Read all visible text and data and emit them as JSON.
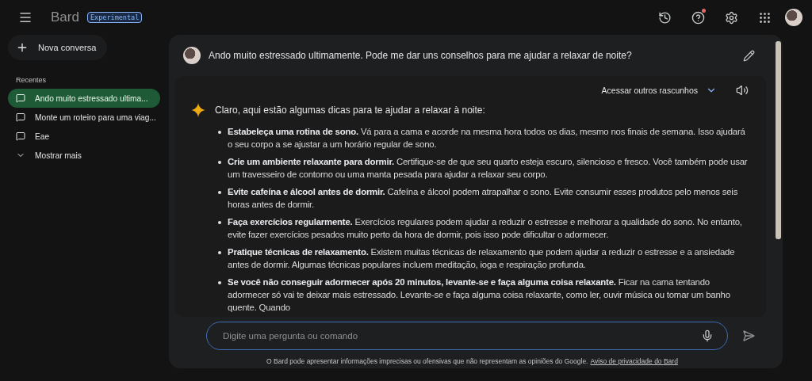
{
  "header": {
    "brand": "Bard",
    "badge": "Experimental",
    "help_notification": true
  },
  "sidebar": {
    "new_chat": "Nova conversa",
    "section": "Recentes",
    "items": [
      {
        "label": "Ando muito estressado ultima...",
        "selected": true
      },
      {
        "label": "Monte um roteiro para uma viag...",
        "selected": false
      },
      {
        "label": "Eae",
        "selected": false
      }
    ],
    "show_more": "Mostrar mais"
  },
  "prompt": {
    "text": "Ando muito estressado ultimamente. Pode me dar uns conselhos para me ajudar a relaxar de noite?"
  },
  "response": {
    "drafts_label": "Acessar outros rascunhos",
    "intro": "Claro, aqui estão algumas dicas para te ajudar a relaxar à noite:",
    "tips": [
      "**Estabeleça uma rotina de sono.** Vá para a cama e acorde na mesma hora todos os dias, mesmo nos finais de semana. Isso ajudará o seu corpo a se ajustar a um horário regular de sono.",
      "**Crie um ambiente relaxante para dormir.** Certifique-se de que seu quarto esteja escuro, silencioso e fresco. Você também pode usar um travesseiro de contorno ou uma manta pesada para ajudar a relaxar seu corpo.",
      "**Evite cafeína e álcool antes de dormir.** Cafeína e álcool podem atrapalhar o sono. Evite consumir esses produtos pelo menos seis horas antes de dormir.",
      "**Faça exercícios regularmente.** Exercícios regulares podem ajudar a reduzir o estresse e melhorar a qualidade do sono. No entanto, evite fazer exercícios pesados muito perto da hora de dormir, pois isso pode dificultar o adormecer.",
      "**Pratique técnicas de relaxamento.** Existem muitas técnicas de relaxamento que podem ajudar a reduzir o estresse e a ansiedade antes de dormir. Algumas técnicas populares incluem meditação, ioga e respiração profunda.",
      "**Se você não conseguir adormecer após 20 minutos, levante-se e faça alguma coisa relaxante.** Ficar na cama tentando adormecer só vai te deixar mais estressado. Levante-se e faça alguma coisa relaxante, como ler, ouvir música ou tomar um banho quente. Quando"
    ]
  },
  "input": {
    "placeholder": "Digite uma pergunta ou comando"
  },
  "footer": {
    "disclaimer": "O Bard pode apresentar informações imprecisas ou ofensivas que não representam as opiniões do Google.",
    "link": "Aviso de privacidade do Bard"
  }
}
